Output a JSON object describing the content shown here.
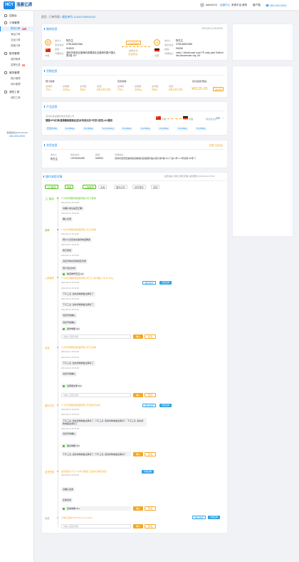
{
  "header": {
    "logo_cn": "海晨亿通",
    "logo_en": "HAICHEN YITONG",
    "logo_mark": "HCY",
    "user": "admin123",
    "nav": [
      "运营中心",
      "系统平台",
      "我的",
      "客户端"
    ],
    "active_nav": "运营中心",
    "phone": "400-000-0000"
  },
  "sidebar": {
    "items": [
      {
        "label": "控制台",
        "icon": "dashboard-icon"
      },
      {
        "label": "订单管理",
        "icon": "order-icon",
        "subs": [
          {
            "label": "物流订单",
            "badge": "99+",
            "active": true
          },
          {
            "label": "海运订单"
          },
          {
            "label": "空运订单"
          },
          {
            "label": "铁路订单"
          }
        ]
      },
      {
        "label": "账务管理",
        "icon": "finance-icon",
        "subs": [
          {
            "label": "我的账单"
          },
          {
            "label": "发票记录",
            "badge": "新"
          }
        ]
      },
      {
        "label": "服务管理",
        "icon": "service-icon",
        "subs": [
          {
            "label": "报价管理"
          },
          {
            "label": "询价管理"
          }
        ]
      },
      {
        "label": "我的工单",
        "icon": "ticket-icon",
        "subs": [
          {
            "label": "我的工单"
          }
        ]
      }
    ],
    "contact_label": "客服热线(9:00-18:00)",
    "contact_phone": "400-000-0000"
  },
  "breadcrumb": {
    "prefix": "首页 / 订单列表 / ",
    "current": "服务单号:1LMLS789031100"
  },
  "route": {
    "title": "路线信息",
    "from_tag": "起",
    "from_country": "中国",
    "from": {
      "sender_label": "发件人",
      "sender": "陈先生",
      "phone_label": "联系电话",
      "phone": "0755-88820366",
      "zip_label": "邮编",
      "zip": "518000",
      "addr_label": "详细地址",
      "addr": "深圳市宝安区福海街道展城社区福港东路兴围大厦2楼 11F"
    },
    "status_tag": "在途运输中",
    "mode_label": "运输方式",
    "mode": "空运转运",
    "to_country": "德国",
    "to": {
      "recv_label": "收件人",
      "recv": "陈先生",
      "phone_label": "联系电话",
      "phone": "0755-88820366",
      "zip_label": "邮编",
      "zip": "D6958",
      "addr_label": "详细地址",
      "addr": "units 1 Workhouse road TR unity park Salford dst Manchester city, UK"
    },
    "time": "2019-05-14 15:30:30"
  },
  "cargo": {
    "title": "货物信息",
    "groups": [
      {
        "name": "预计货物",
        "items": [
          {
            "label": "总体积",
            "value": "70",
            "unit": "m³"
          },
          {
            "label": "总重量",
            "value": "150",
            "unit": "kg"
          },
          {
            "label": "总件数",
            "value": "20",
            "unit": "件"
          },
          {
            "label": "货值",
            "value": "¥8120.00",
            "unit": ""
          }
        ]
      },
      {
        "name": "实际货物",
        "items": [
          {
            "label": "总体积",
            "value": "70",
            "unit": "m³"
          },
          {
            "label": "总重量",
            "value": "150",
            "unit": "kg"
          },
          {
            "label": "总件数",
            "value": "20",
            "unit": "件"
          },
          {
            "label": "货值",
            "value": "¥8120.00",
            "unit": ""
          }
        ]
      }
    ],
    "total_label": "实付运费(预估)",
    "total": "¥8125.00",
    "total_tag": "待付款"
  },
  "product": {
    "title": "产品信息",
    "company": "深圳市海运国际物流有限公司",
    "name": "德国UPS红单(普通集装箱海运)空派专线(出关+代发+送货)-IAS服务",
    "origin_label": "中国",
    "dest_label": "德国",
    "price_label": "物流总运费",
    "price": "50",
    "chips": [
      "亚马逊 FBA",
      "Top 500kg",
      "Top 500kg",
      "Top Ordering",
      "Top 500kg",
      "Top 500kg",
      "Top 500kg",
      "Top 500kg",
      "Top 500kg"
    ]
  },
  "delivery": {
    "title": "交货信息",
    "link": "查看门店信息",
    "fields": [
      {
        "label": "收件人",
        "value": "陈先生"
      },
      {
        "label": "联系电话",
        "value": "13378461890"
      },
      {
        "label": "邮编",
        "value": "525000"
      },
      {
        "label": "详细地址",
        "value": "深圳市宝安区福海街道展城社区福港东路兴围大厦2楼 11F 门禁 2号 C 2号货架 56号门"
      }
    ]
  },
  "tracking": {
    "title": "操作流程详情",
    "subtitle": "最新动态: 你的订单已处理, 最新更新 2019-05-14 15:30",
    "tabs": [
      "上门取件",
      "接单",
      "入库操作",
      "出库",
      "国内清关",
      "送货签收",
      "完成"
    ],
    "events": [
      {
        "stage": "上门取件",
        "text": "广州市天翔物流集团有限公司 已揽收",
        "meta": "2019-05-14 15:30:00",
        "msgs": [
          "请确认地址是否正确!",
          "确认无误"
        ]
      },
      {
        "stage": "接单",
        "text": "广州市天翔物流集团有限公司 已接单",
        "meta": "2019-05-14 15:30:00",
        "msgs": [
          "预计今天揽收请保持电话畅通",
          "我已收到",
          "请您尽快将货物送至仓库",
          "预计到达时间"
        ],
        "file": "物流单号凭证.xlsx"
      },
      {
        "stage": "入库操作",
        "text": "广州市天翔物流集团有限公司 已入库 箱数 4 件 共 25kg",
        "meta": "2019-05-14 15:30:00",
        "msgs": [
          "下午三点, 您的货物准备出库好了",
          "下午三点, 您的货物准备出库好了",
          "请您尽快确认",
          "请您尽快确认"
        ],
        "file": "操作单据.xlsx",
        "btn_confirm": "确认",
        "btn_cancel": "取消"
      },
      {
        "stage": "出库",
        "text": "广州市天翔物流集团有限公司 已出库",
        "meta": "2019-05-14 15:30:00",
        "msgs": [
          "下午三点, 您的货物准备出库好了",
          "请您尽快确认"
        ],
        "file": "出库报关单.xlsx",
        "btn_confirm": "确认",
        "btn_cancel": "取消"
      },
      {
        "stage": "国内清关",
        "text": "广州市天翔物流集团有限公司 国内清关中",
        "meta": "2019-05-14 15:30:00",
        "msgs": [
          "下午三点, 您的货物准备出库好了, 下午三点, 您的货物准备出库好了, 下午三点, 您的货物准备出库好了",
          "请您尽快确认",
          "下午三点, 您的货物准备出库好了, 下午三点, 您的货物准备出库好了"
        ],
        "file": "报关单据.xlsx",
        "btn_confirm": "确认",
        "btn_cancel": "取消"
      },
      {
        "stage": "送货签收",
        "text": "送货签收 广东 广州市 海珠区 已签收 货物已送达",
        "meta": "2019-05-14 15:30:00",
        "msgs": [
          "请确认签收",
          "签收完成"
        ],
        "file": "签收单据.xlsx",
        "btn_confirm": "确认",
        "btn_cancel": "取消"
      },
      {
        "stage": "完成",
        "text": "订单已完成 2019-05-14 15:30:00",
        "meta": "",
        "btn_confirm": "确认",
        "btn_cancel": "取消"
      }
    ],
    "reply_placeholder": "请输入回复内容",
    "extra_buttons": [
      "确认收货",
      "查看回单"
    ]
  },
  "colors": {
    "accent": "#1e88e5",
    "orange": "#f5a623",
    "green": "#52c41a"
  }
}
